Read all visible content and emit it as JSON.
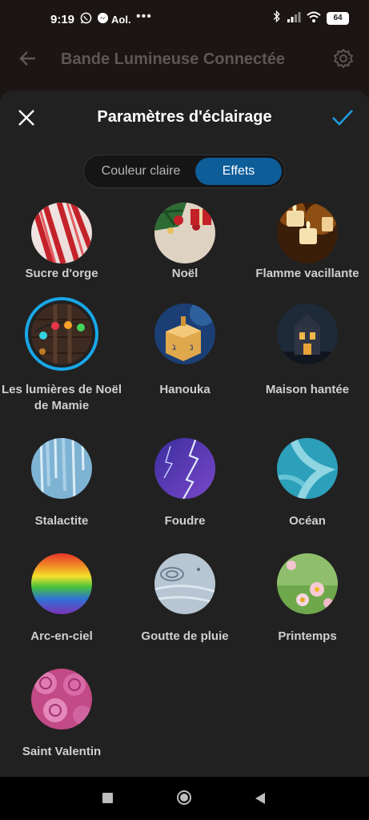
{
  "status_bar": {
    "time": "9:19",
    "aol": "Aol.",
    "dots": "•••",
    "battery": "64"
  },
  "app_bar": {
    "title": "Bande Lumineuse Connectée"
  },
  "sheet": {
    "title": "Paramètres d'éclairage",
    "tabs": [
      {
        "label": "Couleur claire",
        "selected": false
      },
      {
        "label": "Effets",
        "selected": true
      }
    ]
  },
  "effects": [
    {
      "label": "Sucre d'orge",
      "icon": "candy-cane-image"
    },
    {
      "label": "Noël",
      "icon": "christmas-image"
    },
    {
      "label": "Flamme vacillante",
      "icon": "candle-flame-image"
    },
    {
      "label": "Les lumières de Noël de Mamie",
      "icon": "string-lights-image",
      "selected": true
    },
    {
      "label": "Hanouka",
      "icon": "dreidel-image"
    },
    {
      "label": "Maison hantée",
      "icon": "haunted-house-image"
    },
    {
      "label": "Stalactite",
      "icon": "icicle-image"
    },
    {
      "label": "Foudre",
      "icon": "lightning-image"
    },
    {
      "label": "Océan",
      "icon": "ocean-image"
    },
    {
      "label": "Arc-en-ciel",
      "icon": "rainbow-image"
    },
    {
      "label": "Goutte de pluie",
      "icon": "raindrop-image"
    },
    {
      "label": "Printemps",
      "icon": "spring-flowers-image"
    },
    {
      "label": "Saint Valentin",
      "icon": "roses-image"
    }
  ],
  "colors": {
    "accent": "#19a7e8",
    "tab_selected": "#0d5d99",
    "sheet_bg": "#212121"
  }
}
